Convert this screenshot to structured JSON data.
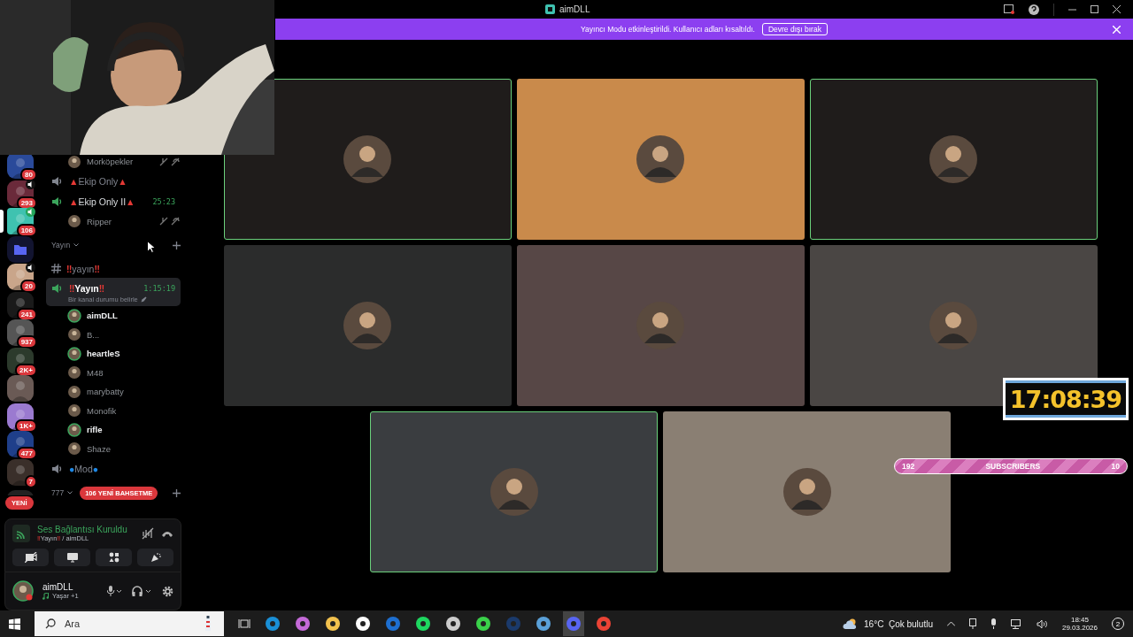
{
  "window": {
    "title": "aimDLL"
  },
  "banner": {
    "text": "Yayıncı Modu etkinleştirildi. Kullanıcı adları kısaltıldı.",
    "button": "Devre dışı bırak"
  },
  "servers": [
    {
      "kind": "server",
      "badge": "80",
      "color": "#2a4a9a",
      "voice": false,
      "selected": false
    },
    {
      "kind": "server",
      "badge": "293",
      "color": "#6a2a3a",
      "voice": true,
      "selected": false
    },
    {
      "kind": "server",
      "badge": "106",
      "color": "#3fc2b0",
      "voice": true,
      "selected": true
    },
    {
      "kind": "folder",
      "color": "#5865f2",
      "voice": false,
      "selected": false
    },
    {
      "kind": "server",
      "badge": "20",
      "color": "#c9a58a",
      "voice": true,
      "selected": false
    },
    {
      "kind": "server",
      "badge": "241",
      "color": "#1a1a1a",
      "voice": false,
      "selected": false
    },
    {
      "kind": "server",
      "badge": "937",
      "color": "#555555",
      "voice": false,
      "selected": false
    },
    {
      "kind": "server",
      "badge": "2K+",
      "color": "#2c3a2c",
      "voice": false,
      "selected": false
    },
    {
      "kind": "server",
      "color": "#6a5a55",
      "voice": false,
      "selected": false
    },
    {
      "kind": "server",
      "badge": "1K+",
      "color": "#9b7ad0",
      "voice": false,
      "selected": false
    },
    {
      "kind": "server",
      "badge": "477",
      "color": "#1f3f8a",
      "voice": false,
      "selected": false
    },
    {
      "kind": "server",
      "badge": "7",
      "color": "#3a2f2a",
      "voice": false,
      "selected": false
    },
    {
      "kind": "server",
      "color": "#222222",
      "voice": false,
      "selected": false,
      "partial": true
    }
  ],
  "new_pill": "YENİ",
  "channels": [
    {
      "kind": "user",
      "name": "Morköpekler",
      "muted": true,
      "speaking": false,
      "bold": false
    },
    {
      "kind": "voice",
      "prefix": "▲",
      "name": "Ekip Only",
      "suffix": "▲",
      "color": "#e53935",
      "active": false,
      "selected": false
    },
    {
      "kind": "voice",
      "prefix": "▲",
      "name": "Ekip Only II",
      "suffix": "▲",
      "color": "#e53935",
      "active": true,
      "selected": false,
      "timer": "25:23",
      "members": [
        {
          "name": "Ripper",
          "muted": true,
          "speaking": false,
          "bold": false
        }
      ]
    },
    {
      "kind": "category",
      "name": "Yayın"
    },
    {
      "kind": "text",
      "prefix": "‼",
      "name": "yayın",
      "suffix": "‼",
      "color": "#e53935"
    },
    {
      "kind": "voice",
      "prefix": "‼",
      "name": "Yayın",
      "suffix": "‼",
      "color": "#e53935",
      "active": true,
      "selected": true,
      "timer": "1:15:19",
      "status": "Bir kanal durumu belirle",
      "members": [
        {
          "name": "aimDLL",
          "muted": false,
          "speaking": true,
          "bold": true
        },
        {
          "name": "B...",
          "muted": false,
          "speaking": false,
          "bold": false
        },
        {
          "name": "heartleS",
          "muted": false,
          "speaking": true,
          "bold": true
        },
        {
          "name": "M48",
          "muted": false,
          "speaking": false,
          "bold": false
        },
        {
          "name": "marybatty",
          "muted": false,
          "speaking": false,
          "bold": false
        },
        {
          "name": "Monofik",
          "muted": false,
          "speaking": false,
          "bold": false
        },
        {
          "name": "rifle",
          "muted": false,
          "speaking": true,
          "bold": true
        },
        {
          "name": "Shaze",
          "muted": false,
          "speaking": false,
          "bold": false
        }
      ]
    },
    {
      "kind": "voice",
      "prefix": "●",
      "name": "Mod",
      "suffix": "●",
      "color": "#1e88e5",
      "active": false,
      "selected": false
    },
    {
      "kind": "category",
      "name": "777",
      "mentions": "106 YENİ BAHSETME"
    }
  ],
  "voice_panel": {
    "status": "Ses Bağlantısı Kuruldu",
    "prefix": "‼",
    "channel": "Yayın",
    "suffix": "‼",
    "server": " / aimDLL"
  },
  "user_panel": {
    "name": "aimDLL",
    "activity": "Yaşar +1"
  },
  "tiles": [
    {
      "color": "#1f1c1b",
      "speaking": true
    },
    {
      "color": "#c98a4b",
      "speaking": false
    },
    {
      "color": "#1f1c1b",
      "speaking": true
    },
    {
      "color": "#2b2c2c",
      "speaking": false
    },
    {
      "color": "#574746",
      "speaking": false
    },
    {
      "color": "#4a4644",
      "speaking": false
    },
    {
      "color": "#3a3d40",
      "speaking": true
    },
    {
      "color": "#8a7f73",
      "speaking": false
    }
  ],
  "timer_overlay": "17:08:39",
  "subscribers": {
    "current": "192",
    "label": "SUBSCRIBERS",
    "goal": "10"
  },
  "taskbar": {
    "search": "Ara",
    "apps": [
      {
        "color": "#1a8fd6",
        "active": false
      },
      {
        "color": "#c46ad8",
        "active": false
      },
      {
        "color": "#f2c14e",
        "active": false
      },
      {
        "color": "#ffffff",
        "active": false
      },
      {
        "color": "#1e6fd0",
        "active": false
      },
      {
        "color": "#1ed760",
        "active": false
      },
      {
        "color": "#cccccc",
        "active": false
      },
      {
        "color": "#3ad14a",
        "active": false
      },
      {
        "color": "#1b3a6b",
        "active": false
      },
      {
        "color": "#5aa0d8",
        "active": false
      },
      {
        "color": "#5865f2",
        "active": true
      },
      {
        "color": "#ea4335",
        "active": false
      }
    ],
    "weather": "16°C  Çok bulutlu",
    "time": "18:45",
    "date": "29.03.2026",
    "notifications": "2"
  }
}
